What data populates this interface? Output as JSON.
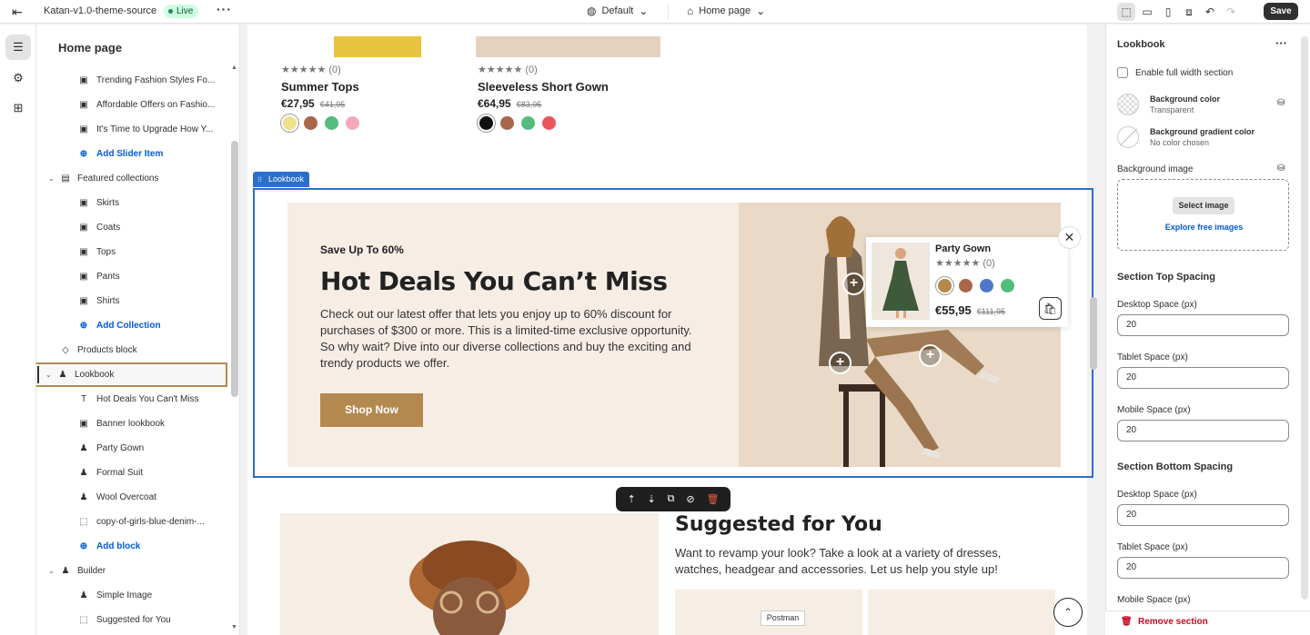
{
  "topbar": {
    "app_name": "Katan-v1.0-theme-source",
    "status": "Live",
    "theme": "Default",
    "page": "Home page",
    "save_label": "Save"
  },
  "sidebar": {
    "title": "Home page",
    "items": [
      {
        "label": "Trending Fashion Styles Fo...",
        "level": 2,
        "icon": "image"
      },
      {
        "label": "Affordable Offers on Fashio...",
        "level": 2,
        "icon": "image"
      },
      {
        "label": "It's Time to Upgrade How Y...",
        "level": 2,
        "icon": "image"
      },
      {
        "label": "Add Slider Item",
        "level": 2,
        "icon": "plus",
        "add": true
      },
      {
        "label": "Featured collections",
        "level": 1,
        "icon": "collection",
        "expanded": true
      },
      {
        "label": "Skirts",
        "level": 2,
        "icon": "image"
      },
      {
        "label": "Coats",
        "level": 2,
        "icon": "image"
      },
      {
        "label": "Tops",
        "level": 2,
        "icon": "image"
      },
      {
        "label": "Pants",
        "level": 2,
        "icon": "image"
      },
      {
        "label": "Shirts",
        "level": 2,
        "icon": "image"
      },
      {
        "label": "Add Collection",
        "level": 2,
        "icon": "plus",
        "add": true
      },
      {
        "label": "Products block",
        "level": 1,
        "icon": "tag"
      },
      {
        "label": "Lookbook",
        "level": 1,
        "icon": "person",
        "expanded": true,
        "selected": true
      },
      {
        "label": "Hot Deals You Can't Miss",
        "level": 2,
        "icon": "text"
      },
      {
        "label": "Banner lookbook",
        "level": 2,
        "icon": "image"
      },
      {
        "label": "Party Gown",
        "level": 2,
        "icon": "person"
      },
      {
        "label": "Formal Suit",
        "level": 2,
        "icon": "person"
      },
      {
        "label": "Wool Overcoat",
        "level": 2,
        "icon": "person"
      },
      {
        "label": "copy-of-girls-blue-denim-...",
        "level": 2,
        "icon": "dashed"
      },
      {
        "label": "Add block",
        "level": 2,
        "icon": "plus",
        "add": true
      },
      {
        "label": "Builder",
        "level": 1,
        "icon": "person",
        "expanded": true
      },
      {
        "label": "Simple Image",
        "level": 2,
        "icon": "person"
      },
      {
        "label": "Suggested for You",
        "level": 2,
        "icon": "dashed"
      }
    ]
  },
  "products": [
    {
      "name": "Summer Tops",
      "rating": "★★★★★ (0)",
      "price": "€27,95",
      "compare": "€41,95",
      "swatches": [
        "#f0e08a",
        "#a8674a",
        "#52bd7e",
        "#f5a9b8"
      ]
    },
    {
      "name": "Sleeveless Short Gown",
      "rating": "★★★★★ (0)",
      "price": "€64,95",
      "compare": "€83,95",
      "swatches": [
        "#111111",
        "#a8674a",
        "#52bd7e",
        "#e8555f"
      ]
    }
  ],
  "lookbook": {
    "tag": "Lookbook",
    "eyebrow": "Save Up To 60%",
    "heading": "Hot Deals You Can’t Miss",
    "body": "Check out our latest offer that lets you enjoy up to 60% discount for purchases of $300 or more. This is a limited-time exclusive opportunity. So why wait? Dive into our diverse collections and buy the exciting and trendy products we offer.",
    "button": "Shop Now",
    "popup": {
      "name": "Party Gown",
      "rating": "★★★★★ (0)",
      "price": "€55,95",
      "compare": "€111,95",
      "swatches": [
        "#b4894f",
        "#a8674a",
        "#4e77c9",
        "#52bd7e"
      ]
    }
  },
  "suggested": {
    "title": "Suggested for You",
    "description": "Want to revamp your look? Take a look at a variety of dresses, watches, headgear and accessories. Let us help you style up!",
    "tooltip": "Postman"
  },
  "settings": {
    "title": "Lookbook",
    "full_width_label": "Enable full width section",
    "bg_color_label": "Background color",
    "bg_color_value": "Transparent",
    "bg_gradient_label": "Background gradient color",
    "bg_gradient_value": "No color chosen",
    "bg_image_label": "Background image",
    "select_image": "Select image",
    "explore_images": "Explore free images",
    "top_spacing_title": "Section Top Spacing",
    "bottom_spacing_title": "Section Bottom Spacing",
    "desktop_label": "Desktop Space (px)",
    "tablet_label": "Tablet Space (px)",
    "mobile_label": "Mobile Space (px)",
    "top_desktop": "20",
    "top_tablet": "20",
    "top_mobile": "20",
    "bottom_desktop": "20",
    "bottom_tablet": "20",
    "remove_label": "Remove section"
  },
  "colors": {
    "accent": "#2c6ecb",
    "selected_outline": "#b38a52",
    "brand_button": "#b4894f",
    "danger": "#c70a24"
  }
}
